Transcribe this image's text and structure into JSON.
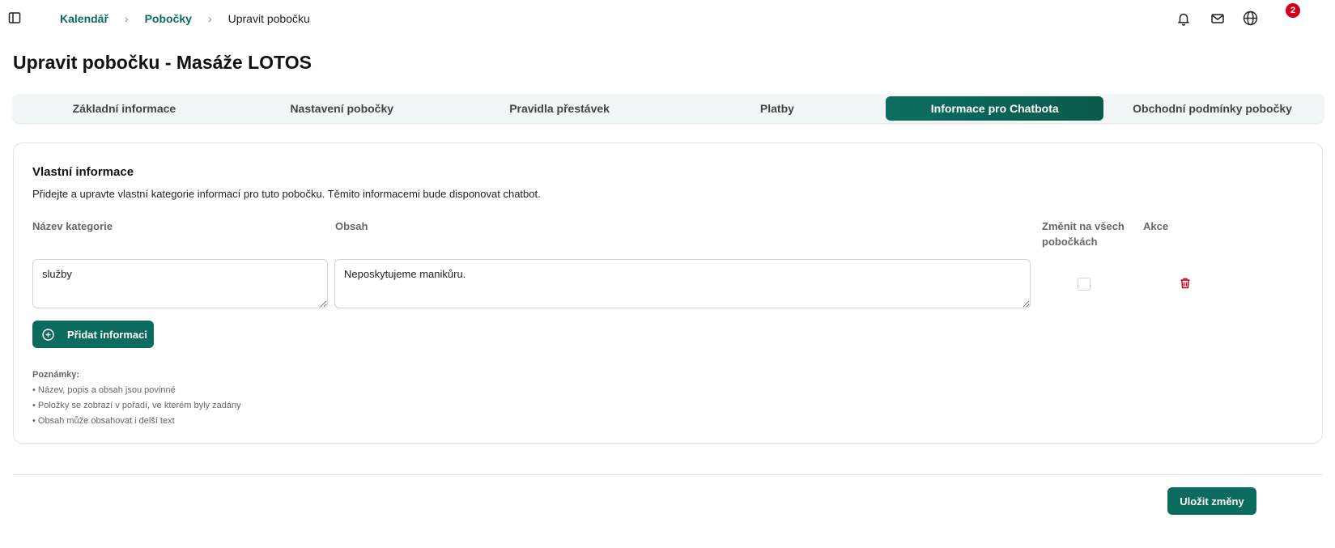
{
  "icons": {
    "sidebar_toggle": "sidebar-icon",
    "bell": "bell-icon",
    "mail": "mail-icon",
    "globe": "globe-icon",
    "add": "plus-circle-icon",
    "delete": "trash-icon"
  },
  "colors": {
    "primary": "#0b6b5c",
    "badge": "#d0021b",
    "delete": "#d0021b"
  },
  "breadcrumb": {
    "items": [
      "Kalendář",
      "Pobočky",
      "Upravit pobočku"
    ]
  },
  "header": {
    "mail_badge": "2"
  },
  "page": {
    "title": "Upravit pobočku - Masáže LOTOS"
  },
  "tabs": [
    {
      "label": "Základní informace",
      "active": false
    },
    {
      "label": "Nastavení pobočky",
      "active": false
    },
    {
      "label": "Pravidla přestávek",
      "active": false
    },
    {
      "label": "Platby",
      "active": false
    },
    {
      "label": "Informace pro Chatbota",
      "active": true
    },
    {
      "label": "Obchodní podmínky pobočky",
      "active": false
    }
  ],
  "section": {
    "title": "Vlastní informace",
    "description": "Přidejte a upravte vlastní kategorie informací pro tuto pobočku. Těmito informacemi bude disponovat chatbot.",
    "columns": {
      "category": "Název kategorie",
      "content": "Obsah",
      "apply_all": "Změnit na všech pobočkách",
      "actions": "Akce"
    },
    "rows": [
      {
        "category": "služby",
        "content": "Neposkytujeme manikůru.",
        "apply_all": false
      }
    ],
    "add_button": "Přidat informaci",
    "notes": {
      "title": "Poznámky:",
      "items": [
        "• Název, popis a obsah jsou povinné",
        "• Položky se zobrazí v pořadí, ve kterém byly zadány",
        "• Obsah může obsahovat i delší text"
      ]
    }
  },
  "footer": {
    "save_button": "Uložit změny"
  }
}
